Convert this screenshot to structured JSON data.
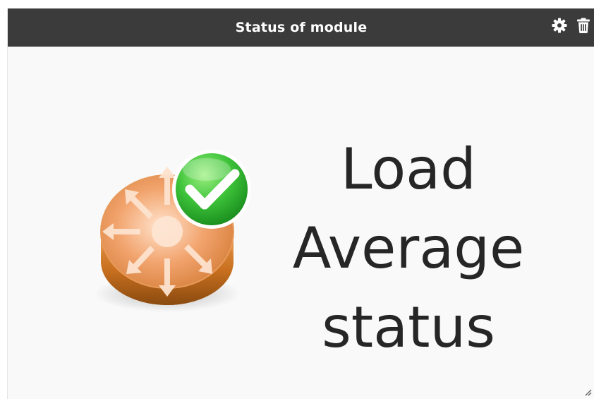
{
  "widget": {
    "title": "Status of module",
    "actions": [
      {
        "name": "configure",
        "icon": "gear-icon"
      },
      {
        "name": "delete",
        "icon": "trash-icon"
      }
    ]
  },
  "module": {
    "icon": "router-ok-icon",
    "status_state": "ok",
    "status_lines": [
      "Load",
      "Average",
      "status"
    ]
  },
  "colors": {
    "titlebar": "#3b3b3b",
    "title_text": "#ffffff",
    "body_bg": "#f9f9f9",
    "status_text": "#262626",
    "ok_green": "#2fb52c",
    "router_orange": "#e8924a"
  }
}
